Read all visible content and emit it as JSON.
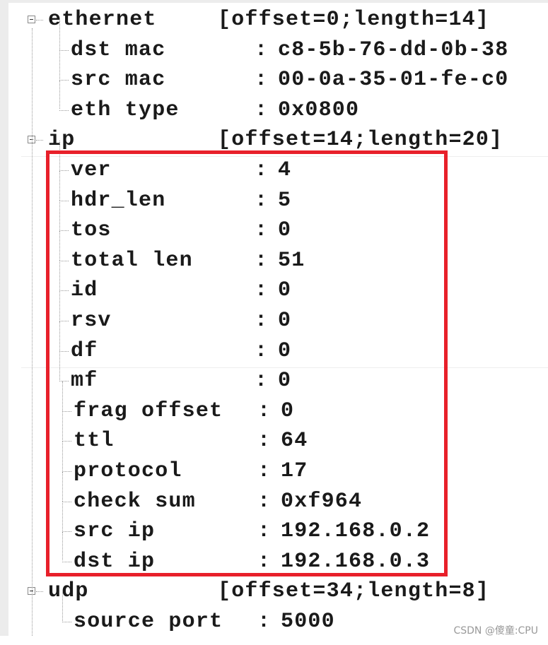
{
  "tree": [
    {
      "type": "section",
      "name": "ethernet",
      "info": "[offset=0;length=14]"
    },
    {
      "type": "field",
      "name": "dst mac",
      "value": "c8-5b-76-dd-0b-38"
    },
    {
      "type": "field",
      "name": "src mac",
      "value": "00-0a-35-01-fe-c0"
    },
    {
      "type": "field",
      "name": "eth type",
      "value": "0x0800",
      "last": true
    },
    {
      "type": "section",
      "name": "ip",
      "info": "[offset=14;length=20]"
    },
    {
      "type": "field",
      "name": "ver",
      "value": "4"
    },
    {
      "type": "field",
      "name": "hdr_len",
      "value": "5"
    },
    {
      "type": "field",
      "name": "tos",
      "value": "0"
    },
    {
      "type": "field",
      "name": "total len",
      "value": "51"
    },
    {
      "type": "field",
      "name": "id",
      "value": "0"
    },
    {
      "type": "field",
      "name": "rsv",
      "value": "0"
    },
    {
      "type": "field",
      "name": "df",
      "value": "0"
    },
    {
      "type": "field",
      "name": "mf",
      "value": "0"
    },
    {
      "type": "field",
      "name": "frag offset",
      "value": "0",
      "shift": true
    },
    {
      "type": "field",
      "name": "ttl",
      "value": "64",
      "shift": true
    },
    {
      "type": "field",
      "name": "protocol",
      "value": "17",
      "shift": true
    },
    {
      "type": "field",
      "name": "check sum",
      "value": "0xf964",
      "shift": true
    },
    {
      "type": "field",
      "name": "src ip",
      "value": "192.168.0.2",
      "shift": true
    },
    {
      "type": "field",
      "name": "dst ip",
      "value": "192.168.0.3",
      "shift": true,
      "last": true
    },
    {
      "type": "section",
      "name": "udp",
      "info": "[offset=34;length=8]"
    },
    {
      "type": "field",
      "name": "source port",
      "value": "5000",
      "shift": true
    }
  ],
  "separator": ":",
  "highlight_color": "#e8202a",
  "watermark": "CSDN @傻童:CPU"
}
